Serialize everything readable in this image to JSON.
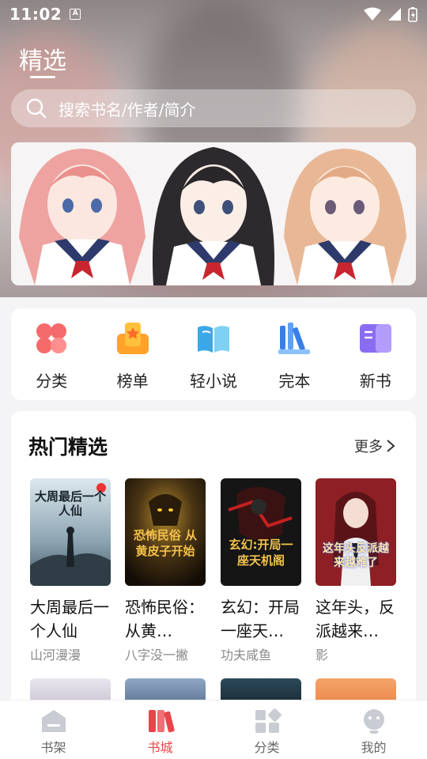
{
  "status_bar": {
    "time": "11:02",
    "notif_letter": "A"
  },
  "header": {
    "title": "精选"
  },
  "search": {
    "placeholder": "搜索书名/作者/简介"
  },
  "categories": [
    {
      "label": "分类",
      "icon": "category-icon"
    },
    {
      "label": "榜单",
      "icon": "ranking-icon"
    },
    {
      "label": "轻小说",
      "icon": "light-novel-icon"
    },
    {
      "label": "完本",
      "icon": "completed-icon"
    },
    {
      "label": "新书",
      "icon": "new-book-icon"
    }
  ],
  "hot": {
    "title": "热门精选",
    "more_label": "更多",
    "books": [
      {
        "title": "大周最后一个人仙",
        "author": "山河漫漫",
        "cover_text": "大周最后一个人仙"
      },
      {
        "title": "恐怖民俗：从黄…",
        "author": "八字没一撇",
        "cover_text": "恐怖民俗 从黄皮子开始"
      },
      {
        "title": "玄幻：开局一座天…",
        "author": "功夫咸鱼",
        "cover_text": "玄幻:开局一座天机阁"
      },
      {
        "title": "这年头，反派越来…",
        "author": "影",
        "cover_text": "这年头反派越来越难了"
      }
    ]
  },
  "tabbar": [
    {
      "label": "书架",
      "icon": "bookshelf-icon",
      "active": false
    },
    {
      "label": "书城",
      "icon": "bookstore-icon",
      "active": true
    },
    {
      "label": "分类",
      "icon": "grid-icon",
      "active": false
    },
    {
      "label": "我的",
      "icon": "profile-icon",
      "active": false
    }
  ],
  "colors": {
    "accent": "#e8454a",
    "background": "#f4f4f6"
  }
}
